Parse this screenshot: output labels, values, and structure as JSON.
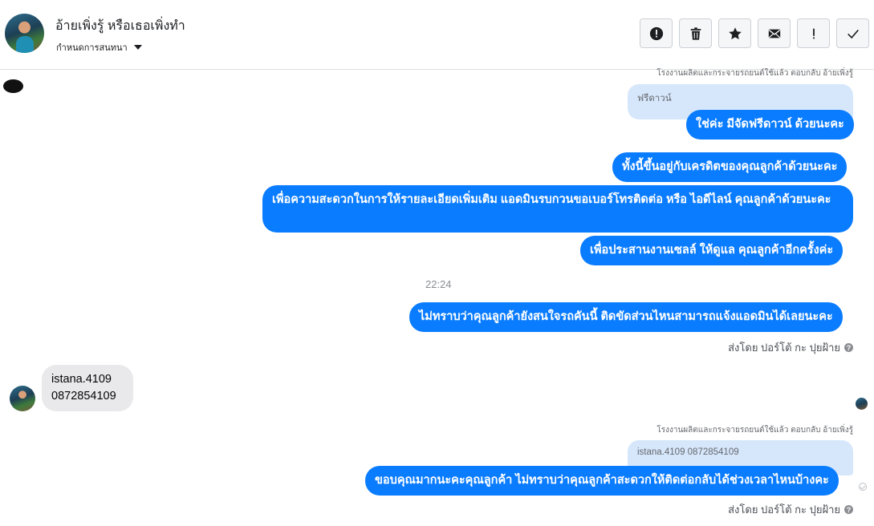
{
  "header": {
    "contact_name": "อ้ายเพิ่งรู้ หรือเธอเพิ่งทำ",
    "settings_label": "กำหนดการสนทนา",
    "actions": [
      {
        "name": "report-spam",
        "icon": "alert-circle-icon"
      },
      {
        "name": "delete",
        "icon": "trash-icon"
      },
      {
        "name": "star",
        "icon": "star-icon"
      },
      {
        "name": "mark-unread",
        "icon": "envelope-icon"
      },
      {
        "name": "important",
        "icon": "exclamation-icon"
      },
      {
        "name": "done",
        "icon": "check-icon"
      }
    ]
  },
  "messages": {
    "reply_note_1": "โรงงานผลิตและกระจายรถยนต์ใช้แล้ว ตอบกลับ อ้ายเพิ่งรู้",
    "quoted_1": "ฟรีดาวน์",
    "msg_1": "ใช่ค่ะ มีจัดฟรีดาวน์ ด้วยนะคะ",
    "msg_2": "ทั้งนี้ขึ้นอยู่กับเครดิตของคุณลูกค้าด้วยนะคะ",
    "msg_3": "เพื่อความสะดวกในการให้รายละเอียดเพิ่มเติม แอดมินรบกวนขอเบอร์โทรติดต่อ หรือ ไอดีไลน์ คุณลูกค้าด้วยนะคะ",
    "msg_4": "เพื่อประสานงานเซลล์ ให้ดูแล คุณลูกค้าอีกครั้งค่ะ",
    "timestamp": "22:24",
    "msg_5": "ไม่ทราบว่าคุณลูกค้ายังสนใจรถคันนี้ ติดขัดส่วนไหนสามารถแจ้งแอดมินได้เลยนะคะ",
    "sent_by_1": "ส่งโดย ปอร์โต้ กะ ปุยฝ้าย",
    "incoming_line1": "istana.4109",
    "incoming_line2": "0872854109",
    "reply_note_2": "โรงงานผลิตและกระจายรถยนต์ใช้แล้ว ตอบกลับ อ้ายเพิ่งรู้",
    "quoted_2": "istana.4109 0872854109",
    "msg_6": "ขอบคุณมากนะคะคุณลูกค้า ไม่ทราบว่าคุณลูกค้าสะดวกให้ติดต่อกลับได้ช่วงเวลาไหนบ้างคะ",
    "sent_by_2": "ส่งโดย ปอร์โต้ กะ ปุยฝ้าย"
  },
  "colors": {
    "outgoing_bubble": "#0a7cff",
    "incoming_bubble": "#e9e9eb",
    "quoted_bubble": "#d6e7fc"
  }
}
